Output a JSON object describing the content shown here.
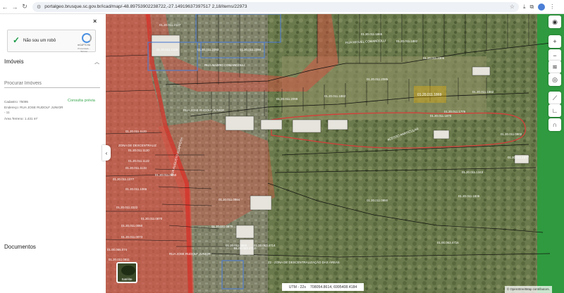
{
  "browser": {
    "url": "portalgeo.brusque.sc.gov.br/icad/map/-48.89753902238722,-27.14919637397517 2,18/items/22973",
    "back_icon": "arrow-left-icon",
    "forward_icon": "arrow-right-icon",
    "reload_icon": "reload-icon"
  },
  "sidebar": {
    "captcha_label": "Não sou um robô",
    "captcha_brand": "reCAPTCHA",
    "captcha_privacy": "Privacidade - Termos",
    "section_title": "Imóveis",
    "search_placeholder": "Procurar Imóveis",
    "cadastro": "Cadastro: 75095",
    "endereco": "Endereço: RUA JOSE RUDOLF JUNIOR",
    "endereco_num": "- 11",
    "area": "Área Terreno: 1.431 m²",
    "consulta_label": "Consulta prévia",
    "documentos_title": "Documentos"
  },
  "map": {
    "labels": [
      {
        "text": "01.20.011.2127"
      },
      {
        "text": "01.20.011.2129"
      },
      {
        "text": "01.20.011.2093"
      },
      {
        "text": "01.20.011.2094"
      },
      {
        "text": "01.20.011.1865"
      },
      {
        "text": "01.20.011.1882"
      },
      {
        "text": "RUA MIGUEL COMANDOLLI"
      },
      {
        "text": "RUA ALMIRO COMANDOLLI"
      },
      {
        "text": "01.20.011.2306"
      },
      {
        "text": "01.20.011.2085"
      },
      {
        "text": "01.20.011.2099"
      },
      {
        "text": "01.20.011.1882"
      },
      {
        "text": "01.20.011.1862"
      },
      {
        "text": "01.20.011.1779"
      },
      {
        "text": "RUA JOSE RUDOLF JUNIOR"
      },
      {
        "text": "01.20.011.1670"
      },
      {
        "text": "01.20.011.1123"
      },
      {
        "text": "01.20.011.1120"
      },
      {
        "text": "01.20.011.1122"
      },
      {
        "text": "01.20.011.1133"
      },
      {
        "text": "01.20.011.1077"
      },
      {
        "text": "01.20.011.1066"
      },
      {
        "text": "ZONA DE DESCENTRALIZ"
      },
      {
        "text": "ACESSO PARTICULAR"
      },
      {
        "text": "01.20.011.0902"
      },
      {
        "text": "01.20.011.1377"
      },
      {
        "text": "01.20.011.1343"
      },
      {
        "text": "01.20.011.0994"
      },
      {
        "text": "01.20.011.0990"
      },
      {
        "text": "01.20.011.0870"
      },
      {
        "text": "01.20.011.0876"
      },
      {
        "text": "01.20.011.0860"
      },
      {
        "text": "01.20.011.0811"
      },
      {
        "text": "01.20.011.2222"
      },
      {
        "text": "01.20.011.0050"
      },
      {
        "text": "01.20.011.0073"
      },
      {
        "text": "01.00.063.4712"
      },
      {
        "text": "01.00.063.4714"
      },
      {
        "text": "01.00.063.4716"
      },
      {
        "text": "01.00.065.074"
      },
      {
        "text": "RUA JOSE RUDOLF JUNIOR"
      },
      {
        "text": "Z2 - ZONA DE DESCENTRALIZAÇÃO DAS ÁREAS"
      },
      {
        "text": "RUA AUGUSTO KLAPPOTH"
      },
      {
        "text": "01.20.011.0850"
      },
      {
        "text": "01.20.011.1839"
      }
    ],
    "selected_parcel": "01.20.011.1869",
    "satellite_label": "Satélite",
    "coords_zone": "UTM - 22s",
    "coords_value": "708054.8614, 6995408.4184",
    "attribution": "© OpenStreetMap contributors."
  },
  "toolbar": {
    "user_icon": "user-icon",
    "zoom_in": "+",
    "zoom_out": "−",
    "layers_icon": "layers-icon",
    "target_icon": "target-icon",
    "ruler_icon": "ruler-icon",
    "angle_icon": "angle-icon",
    "magnet_icon": "magnet-icon"
  }
}
